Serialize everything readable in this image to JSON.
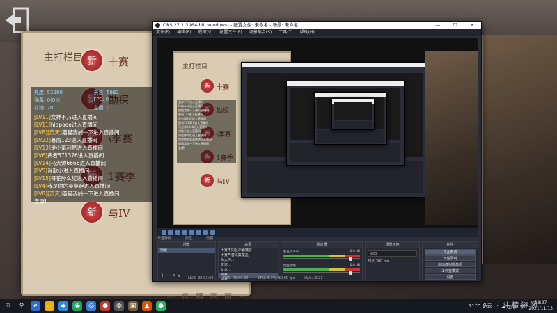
{
  "game": {
    "book_heading": "主打栏目",
    "menu": [
      {
        "badge": "新",
        "label": "十赛"
      },
      {
        "badge": "新",
        "label": "勘探"
      },
      {
        "badge": "新",
        "label": "\\季赛"
      },
      {
        "badge": "新",
        "label": "1赛季"
      },
      {
        "badge": "新",
        "label": "与IV"
      }
    ],
    "bottom_text": "一 直 播 画 面 一"
  },
  "chat": {
    "stats": [
      "热度: 52990",
      "关注: 5982",
      "弹幕: 0(0%)",
      "FPS: 0",
      "礼物: 20",
      "主播: 0"
    ],
    "messages": [
      {
        "lv": "[LV11]",
        "text": "女神不乃进入直播间"
      },
      {
        "lv": "[LV11]",
        "text": "hiapooo进入直播间"
      },
      {
        "lv": "[LV8][荧天]",
        "text": "猫猫我捕一下进入直播间"
      },
      {
        "lv": "[LV22]",
        "text": "暮雨123进入直播间"
      },
      {
        "lv": "[LV13]",
        "text": "是小蕾利尼进入直播间"
      },
      {
        "lv": "[LV6]",
        "text": "费者571376进入直播间"
      },
      {
        "lv": "[LV14]",
        "text": "马大帅6666进入直播间"
      },
      {
        "lv": "[LV5]",
        "text": "肖散小进入直播间"
      },
      {
        "lv": "[LV15]",
        "text": "哥花肿么红进入直播间"
      },
      {
        "lv": "[LV4]",
        "text": "我是你的莫莫跑进入直播间"
      },
      {
        "lv": "[LV8][荧天]",
        "text": "猫猫我捕一下进入直播间"
      },
      {
        "lv": "",
        "text": "安康!"
      }
    ]
  },
  "obs": {
    "title": "OBS 27.1.3 (64-bit, windows) - 配置文件: 未命名 - 场景: 未命名",
    "menu": [
      "文件(F)",
      "编辑(E)",
      "视图(V)",
      "配置文件(P)",
      "场景集合(S)",
      "工具(T)",
      "帮助(H)"
    ],
    "scene_tabs": [
      "未选择源",
      "属性",
      "滤镜"
    ],
    "docks": {
      "scenes": {
        "header": "场景",
        "items": [
          "场景"
        ]
      },
      "sources": {
        "header": "来源",
        "items": [
          "十赛不同显示器捕获",
          "十赛声音采集覆盖",
          "马大帅...",
          "文本...",
          "文本...",
          "弹幕...",
          "弹幕..."
        ]
      },
      "mixer": {
        "header": "混音器",
        "channels": [
          {
            "name": "麦克风/Aux",
            "db": "0.0 dB"
          },
          {
            "name": "桌面音频",
            "db": "0.0 dB"
          }
        ]
      },
      "transitions": {
        "header": "场景转换",
        "selected": "淡出",
        "duration_label": "时长",
        "duration": "300 ms"
      },
      "controls": {
        "header": "控件",
        "buttons": [
          "停止推流",
          "开始录制",
          "启动虚拟摄像机",
          "工作室模式",
          "设置",
          "退出"
        ]
      }
    },
    "status": {
      "live": "LIVE: 00:03:59",
      "rec": "REC: 00:00:00",
      "cpu": "CPU: 6.3%, 60.00 fps",
      "kb": "kb/s: 3521"
    }
  },
  "taskbar": {
    "weather": "11°C 多云",
    "time": "18:27",
    "date": "2021/11/13"
  },
  "watermark": "斗 精 游 阁"
}
